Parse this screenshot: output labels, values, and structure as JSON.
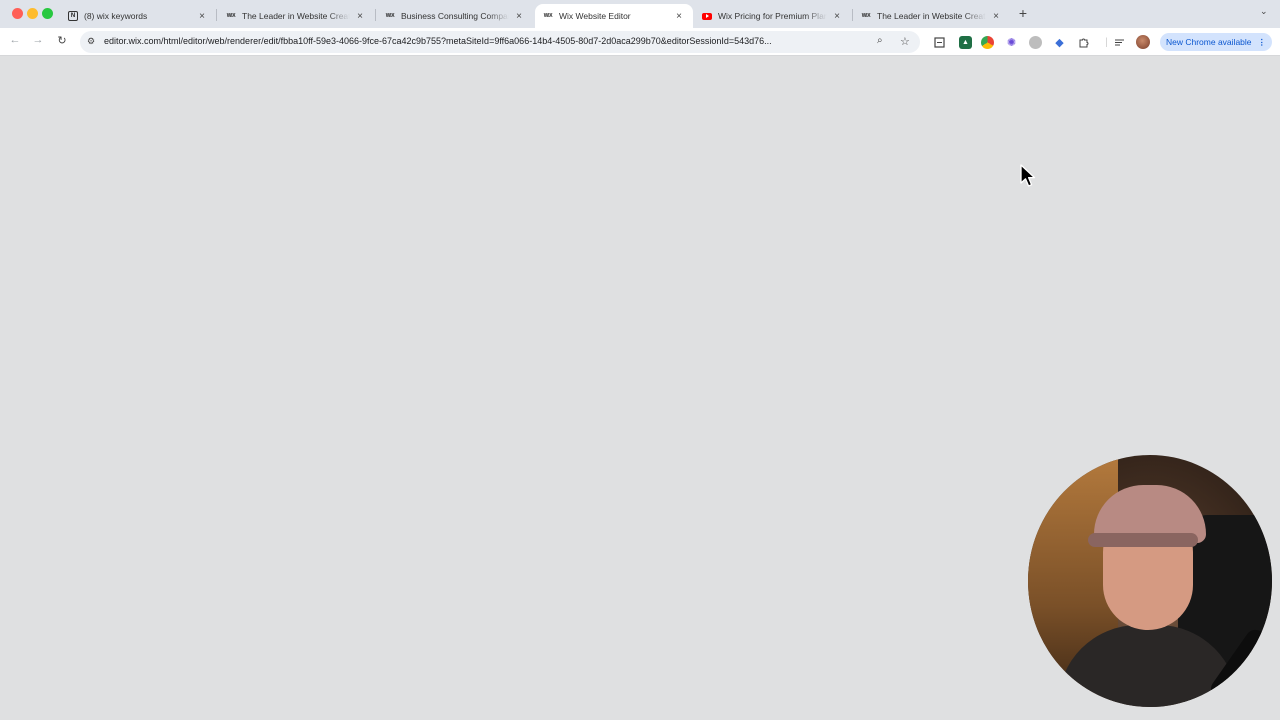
{
  "tabs": [
    {
      "title": "(8) wix keywords",
      "favicon": "notion-icon",
      "active": false
    },
    {
      "title": "The Leader in Website Creati",
      "favicon": "wix-icon",
      "active": false
    },
    {
      "title": "Business Consulting Compan",
      "favicon": "wix-icon",
      "active": false
    },
    {
      "title": "Wix Website Editor",
      "favicon": "wix-icon",
      "active": true
    },
    {
      "title": "Wix Pricing for Premium Plan",
      "favicon": "youtube-icon",
      "active": false
    },
    {
      "title": "The Leader in Website Creati",
      "favicon": "wix-icon",
      "active": false
    }
  ],
  "omnibox": {
    "url": "editor.wix.com/html/editor/web/renderer/edit/fbba10ff-59e3-4066-9fce-67ca42c9b755?metaSiteId=9ff6a066-14b4-4505-80d7-2d0aca299b70&editorSessionId=543d76..."
  },
  "toolbar": {
    "update_label": "New Chrome available"
  },
  "glyphs": {
    "close": "×",
    "newtab": "+",
    "back": "←",
    "forward": "→",
    "reload": "↻",
    "tune": "⚙",
    "zoom": "⌕",
    "star": "☆",
    "menu": "⋮",
    "tabsearch": "⌄",
    "wix": "WiX",
    "notion": "N"
  },
  "colors": {
    "content_bg": "#dfe0e1",
    "tabstrip_bg": "#dfe3ea",
    "update_pill_bg": "#d3e3fd",
    "update_pill_text": "#0b57d0"
  }
}
